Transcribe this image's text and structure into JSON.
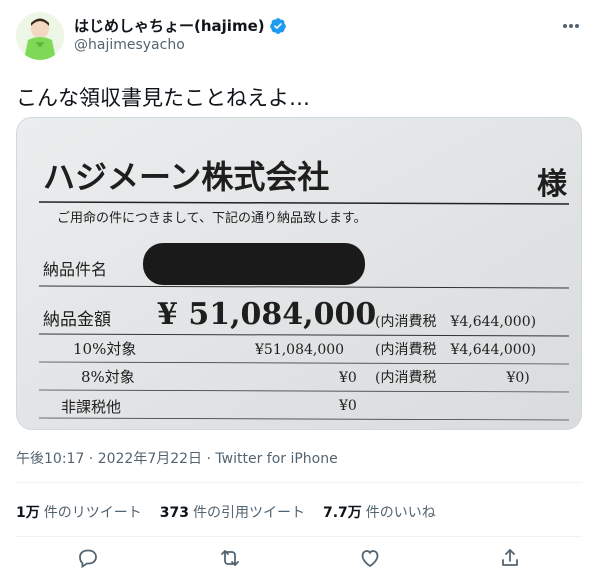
{
  "user": {
    "display_name": "はじめしゃちょー(hajime)",
    "handle": "@hajimesyacho"
  },
  "tweet": {
    "text": "こんな領収書見たことねえよ…",
    "timestamp": "午後10:17 · 2022年7月22日 · ",
    "source": "Twitter for iPhone"
  },
  "stats": [
    {
      "count": "1万",
      "label": "件のリツイート"
    },
    {
      "count": "373",
      "label": "件の引用ツイート"
    },
    {
      "count": "7.7万",
      "label": "件のいいね"
    }
  ],
  "receipt": {
    "company": "ハジメーン株式会社",
    "honorific": "様",
    "intro": "ご用命の件につきまして、下記の通り納品致します。",
    "item_name_label": "納品件名",
    "amount_label": "納品金額",
    "amount": "¥ 51,084,000",
    "amount_tax": "(内消費税　¥4,644,000)",
    "row10_label": "10%対象",
    "row10_amount": "¥51,084,000",
    "row10_tax": "(内消費税　¥4,644,000)",
    "row8_label": "8%対象",
    "row8_amount": "¥0",
    "row8_tax": "(内消費税　　　　　¥0)",
    "nontax_label": "非課税他",
    "nontax_amount": "¥0"
  },
  "icons": {
    "verified": "verified-badge-icon",
    "more": "more-options-icon",
    "reply": "reply-icon",
    "retweet": "retweet-icon",
    "like": "like-icon",
    "share": "share-icon"
  },
  "colors": {
    "verified": "#1d9bf0",
    "secondary_text": "#536471",
    "primary_text": "#0f1419"
  }
}
